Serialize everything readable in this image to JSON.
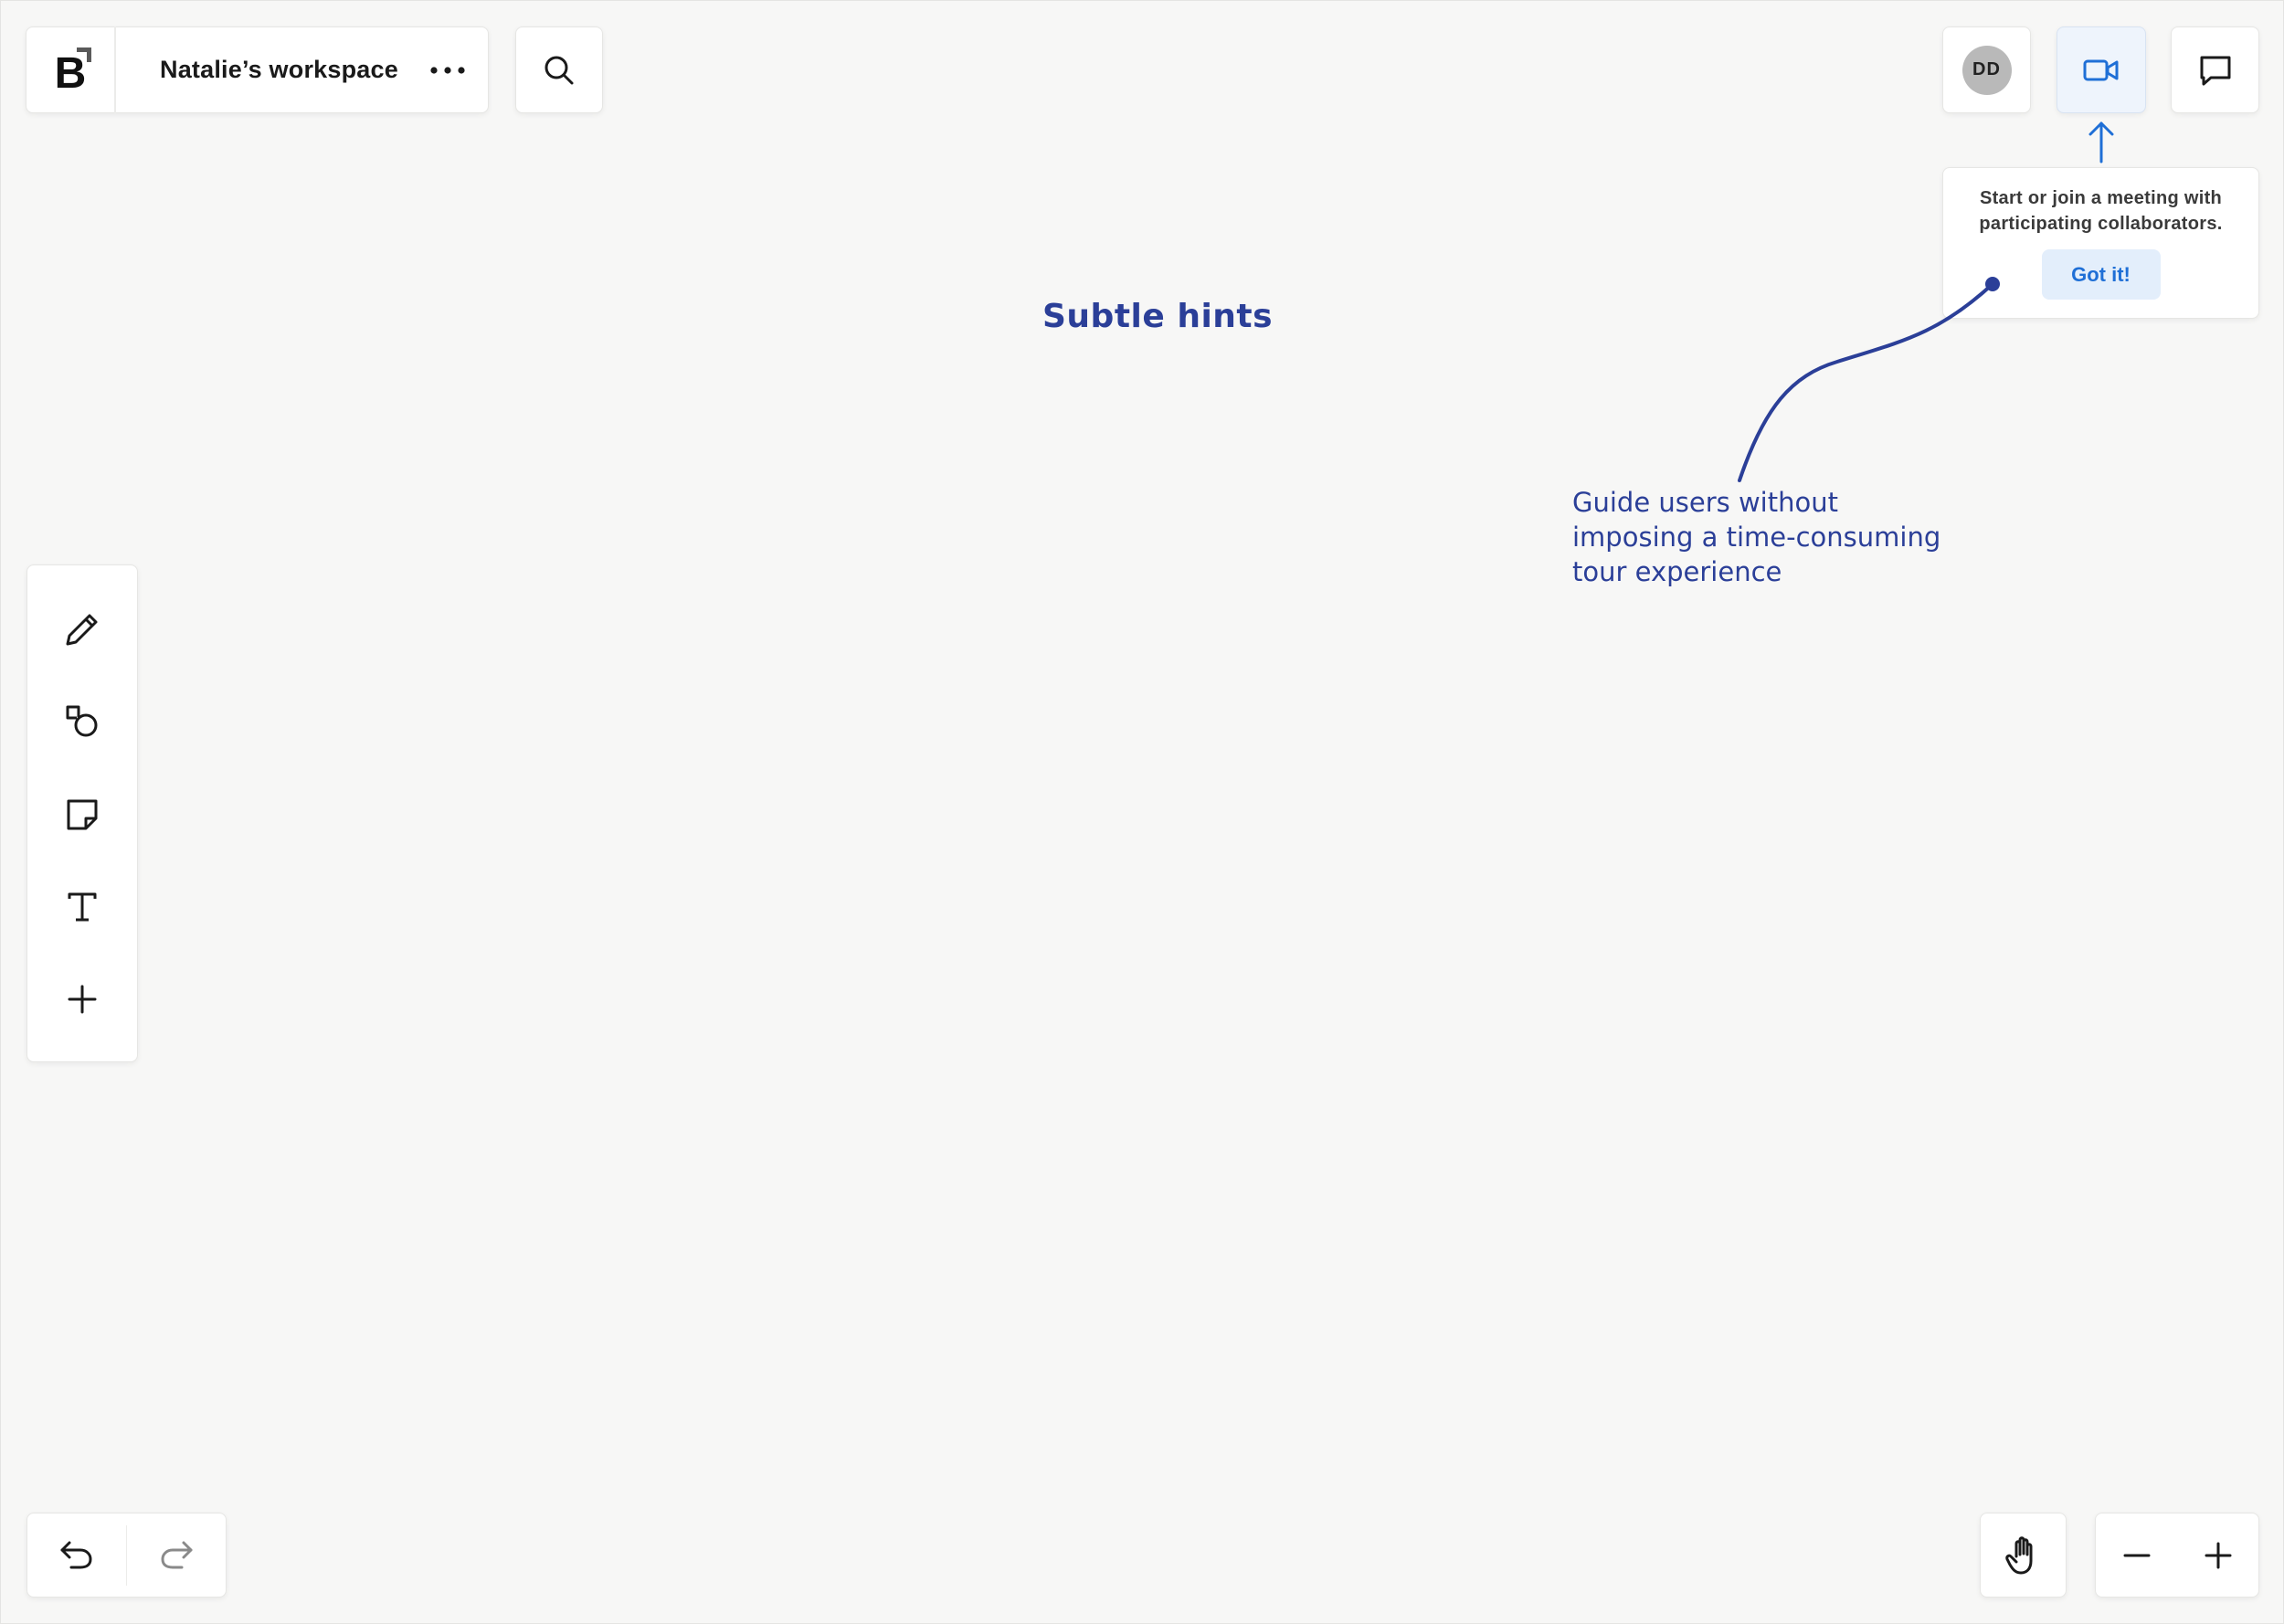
{
  "workspace": {
    "name": "Natalie’s workspace",
    "logo_letter": "B"
  },
  "header": {
    "avatar_initials": "DD"
  },
  "tooltip": {
    "text": "Start or join a meeting with participating collaborators.",
    "button_label": "Got it!"
  },
  "annotations": {
    "title": "Subtle hints",
    "body": "Guide users without\nimposing a time-consuming\ntour experience"
  },
  "toolbar": {
    "tools": [
      {
        "name": "pen",
        "icon": "pencil-icon"
      },
      {
        "name": "shapes",
        "icon": "shapes-icon"
      },
      {
        "name": "sticky-note",
        "icon": "sticky-note-icon"
      },
      {
        "name": "text",
        "icon": "text-icon"
      },
      {
        "name": "add",
        "icon": "plus-icon"
      }
    ]
  },
  "colors": {
    "accent": "#1f6fd6",
    "annotation": "#2b3f98",
    "canvas": "#f7f7f6",
    "video_bg": "#eef4fc"
  }
}
